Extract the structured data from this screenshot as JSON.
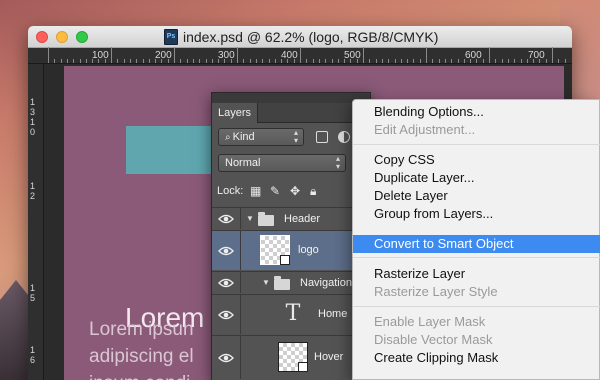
{
  "window": {
    "title": "index.psd @ 62.2% (logo, RGB/8/CMYK)",
    "doc_icon": "Ps"
  },
  "ruler": {
    "top_labels": [
      "100",
      "200",
      "300",
      "400",
      "500",
      "600",
      "700"
    ],
    "left_labels": [
      "1",
      "3",
      "1",
      "0",
      "1",
      "2",
      "1",
      "5",
      "1",
      "6"
    ]
  },
  "canvas": {
    "heading": "Lorem ips",
    "body_lines": [
      "Lorem ipsun",
      "adipiscing el",
      "ipsum condi"
    ],
    "colors": {
      "artboard": "#8a5a78",
      "logo_block": "#5fa6ae"
    }
  },
  "layers_panel": {
    "tab": "Layers",
    "filter_kind": "Kind",
    "blend_mode": "Normal",
    "lock_label": "Lock:",
    "layers": [
      {
        "name": "Header",
        "type": "group",
        "expanded": true
      },
      {
        "name": "logo",
        "type": "smart",
        "selected": true
      },
      {
        "name": "Navigation",
        "type": "group",
        "expanded": true
      },
      {
        "name": "Home",
        "type": "text"
      },
      {
        "name": "Hover",
        "type": "pixel"
      }
    ]
  },
  "context_menu": {
    "items": [
      {
        "label": "Blending Options...",
        "enabled": true
      },
      {
        "label": "Edit Adjustment...",
        "enabled": false
      },
      {
        "label": "Copy CSS",
        "enabled": true
      },
      {
        "label": "Duplicate Layer...",
        "enabled": true
      },
      {
        "label": "Delete Layer",
        "enabled": true
      },
      {
        "label": "Group from Layers...",
        "enabled": true
      },
      {
        "label": "Convert to Smart Object",
        "enabled": true,
        "highlighted": true
      },
      {
        "label": "Rasterize Layer",
        "enabled": true
      },
      {
        "label": "Rasterize Layer Style",
        "enabled": false
      },
      {
        "label": "Enable Layer Mask",
        "enabled": false
      },
      {
        "label": "Disable Vector Mask",
        "enabled": false
      },
      {
        "label": "Create Clipping Mask",
        "enabled": true
      }
    ],
    "highlight_color": "#3d8bf1"
  }
}
